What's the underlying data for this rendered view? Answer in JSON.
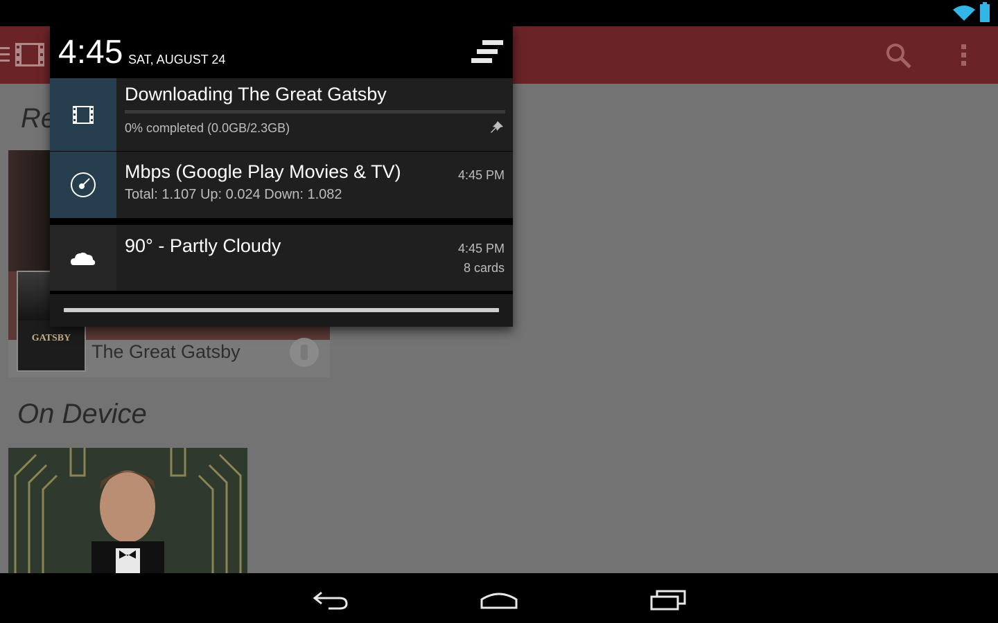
{
  "status_bar": {
    "wifi_icon": "wifi-icon",
    "battery_icon": "battery-icon"
  },
  "app_bar": {
    "color": "#6a2427",
    "menu_icon": "drawer-menu-icon",
    "app_icon": "film-icon",
    "search_icon": "search-icon",
    "overflow_icon": "overflow-menu-icon"
  },
  "content": {
    "recent_title_partial": "Re",
    "recent_item": {
      "title": "The Great Gatsby",
      "poster_text": "GATSBY",
      "action_icon": "pin-download-icon"
    },
    "on_device_title": "On Device"
  },
  "notification_shade": {
    "time": "4:45",
    "date": "SAT, AUGUST 24",
    "clear_icon": "clear-all-icon",
    "notifications": [
      {
        "icon": "film-icon",
        "icon_bg": "#263e4e",
        "title": "Downloading The Great Gatsby",
        "subtitle": "0% completed (0.0GB/2.3GB)",
        "progress": 0,
        "pin_icon": "pin-icon"
      },
      {
        "icon": "speedometer-icon",
        "icon_bg": "#263e4e",
        "title": "Mbps  (Google Play Movies & TV)",
        "subtitle": "Total: 1.107 Up: 0.024 Down: 1.082",
        "time": "4:45 PM"
      },
      {
        "icon": "cloud-icon",
        "icon_bg": "#262626",
        "title": "90° - Partly Cloudy",
        "time": "4:45 PM",
        "extra": "8 cards"
      }
    ]
  },
  "nav_bar": {
    "back_icon": "back-icon",
    "home_icon": "home-icon",
    "recents_icon": "recents-icon"
  }
}
